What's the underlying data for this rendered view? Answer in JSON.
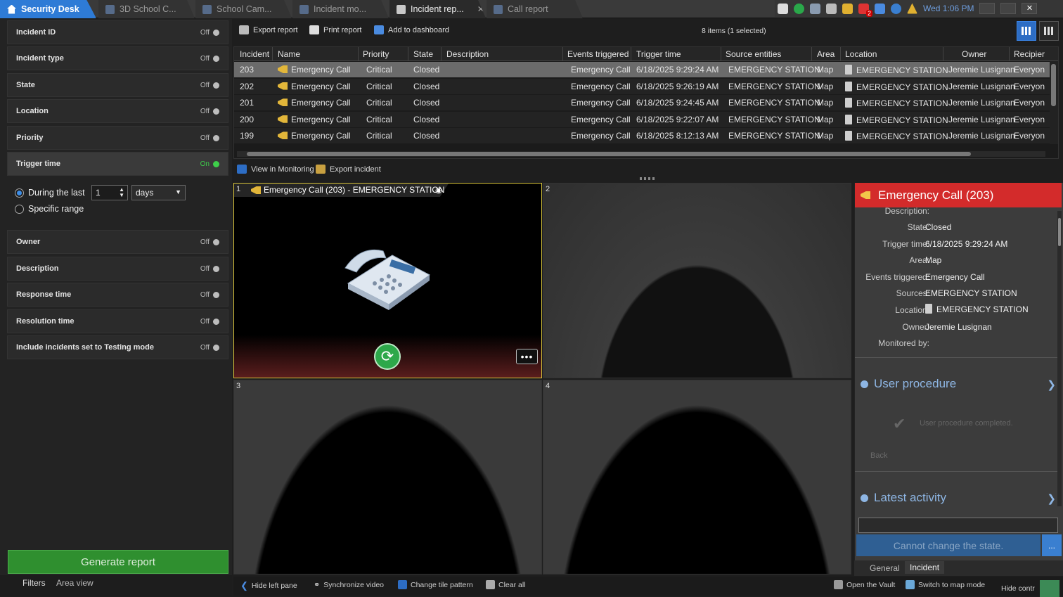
{
  "app": {
    "home_tab": "Security Desk"
  },
  "tabs": [
    {
      "label": "3D School C...",
      "icon": "3d-school-icon"
    },
    {
      "label": "School Cam...",
      "icon": "camera-icon"
    },
    {
      "label": "Incident mo...",
      "icon": "incident-monitoring-icon"
    },
    {
      "label": "Incident rep...",
      "icon": "report-icon",
      "active": true
    },
    {
      "label": "Call report",
      "icon": "call-report-icon"
    }
  ],
  "tray": {
    "clock": "Wed 1:06 PM",
    "badge": "2"
  },
  "filters": {
    "incident_id": {
      "label": "Incident ID",
      "state": "Off"
    },
    "incident_type": {
      "label": "Incident type",
      "state": "Off"
    },
    "state": {
      "label": "State",
      "state": "Off"
    },
    "location": {
      "label": "Location",
      "state": "Off"
    },
    "priority": {
      "label": "Priority",
      "state": "Off"
    },
    "trigger_time": {
      "label": "Trigger time",
      "state": "On",
      "during_label": "During the last",
      "during_value": "1",
      "unit": "days",
      "specific_label": "Specific range"
    },
    "owner": {
      "label": "Owner",
      "state": "Off"
    },
    "description": {
      "label": "Description",
      "state": "Off"
    },
    "response_time": {
      "label": "Response time",
      "state": "Off"
    },
    "resolution_time": {
      "label": "Resolution time",
      "state": "Off"
    },
    "testing_mode": {
      "label": "Include incidents set to Testing mode",
      "state": "Off"
    }
  },
  "generate_report": "Generate report",
  "left_tabs": {
    "filters": "Filters",
    "area_view": "Area view"
  },
  "toolbar": {
    "export": "Export report",
    "print": "Print report",
    "dashboard": "Add to dashboard",
    "count": "8 items (1 selected)"
  },
  "table": {
    "headers": [
      "Incident",
      "Name",
      "Priority",
      "State",
      "Description",
      "Events triggered",
      "Trigger time",
      "Source entities",
      "Area",
      "Location",
      "Owner",
      "Recipier"
    ],
    "rows": [
      [
        "203",
        "Emergency Call",
        "Critical",
        "Closed",
        "",
        "Emergency Call",
        "6/18/2025 9:29:24 AM",
        "EMERGENCY STATION",
        "Map",
        "EMERGENCY STATION",
        "Jeremie Lusignan",
        "Everyon"
      ],
      [
        "202",
        "Emergency Call",
        "Critical",
        "Closed",
        "",
        "Emergency Call",
        "6/18/2025 9:26:19 AM",
        "EMERGENCY STATION",
        "Map",
        "EMERGENCY STATION",
        "Jeremie Lusignan",
        "Everyon"
      ],
      [
        "201",
        "Emergency Call",
        "Critical",
        "Closed",
        "",
        "Emergency Call",
        "6/18/2025 9:24:45 AM",
        "EMERGENCY STATION",
        "Map",
        "EMERGENCY STATION",
        "Jeremie Lusignan",
        "Everyon"
      ],
      [
        "200",
        "Emergency Call",
        "Critical",
        "Closed",
        "",
        "Emergency Call",
        "6/18/2025 9:22:07 AM",
        "EMERGENCY STATION",
        "Map",
        "EMERGENCY STATION",
        "Jeremie Lusignan",
        "Everyon"
      ],
      [
        "199",
        "Emergency Call",
        "Critical",
        "Closed",
        "",
        "Emergency Call",
        "6/18/2025 8:12:13 AM",
        "EMERGENCY STATION",
        "Map",
        "EMERGENCY STATION",
        "Jeremie Lusignan",
        "Everyon"
      ]
    ]
  },
  "subtoolbar": {
    "view_monitoring": "View in Monitoring",
    "export_incident": "Export incident"
  },
  "tiles": {
    "t1_num": "1",
    "t1_title": "Emergency Call (203) - EMERGENCY STATION",
    "t2_num": "2",
    "t3_num": "3",
    "t4_num": "4",
    "menu": "•••"
  },
  "details": {
    "title": "Emergency Call (203)",
    "description_label": "Description:",
    "state_label": "State:",
    "state": "Closed",
    "trigger_label": "Trigger time:",
    "trigger": "6/18/2025 9:29:24 AM",
    "area_label": "Area:",
    "area": "Map",
    "events_label": "Events triggered:",
    "events": "Emergency Call",
    "sources_label": "Sources:",
    "sources": "EMERGENCY STATION",
    "location_label": "Location:",
    "location": "EMERGENCY STATION",
    "owner_label": "Owner:",
    "owner": "Jeremie Lusignan",
    "monitored_label": "Monitored by:",
    "procedure_title": "User procedure",
    "procedure_done": "User procedure completed.",
    "back": "Back",
    "activity_title": "Latest activity",
    "cannot_change": "Cannot change the state.",
    "more": "...",
    "tab_general": "General",
    "tab_incident": "Incident"
  },
  "bottom": {
    "hide_left": "Hide left pane",
    "sync_video": "Synchronize video",
    "change_tile": "Change tile pattern",
    "clear_all": "Clear all",
    "open_vault": "Open the Vault",
    "map_mode": "Switch to map mode",
    "hide_controls": "Hide contr"
  },
  "colors": {
    "accent": "#2e7bd6",
    "alarm_header": "#d32b2b",
    "on_green": "#3ecf4a",
    "generate_green": "#2f8f2f"
  }
}
